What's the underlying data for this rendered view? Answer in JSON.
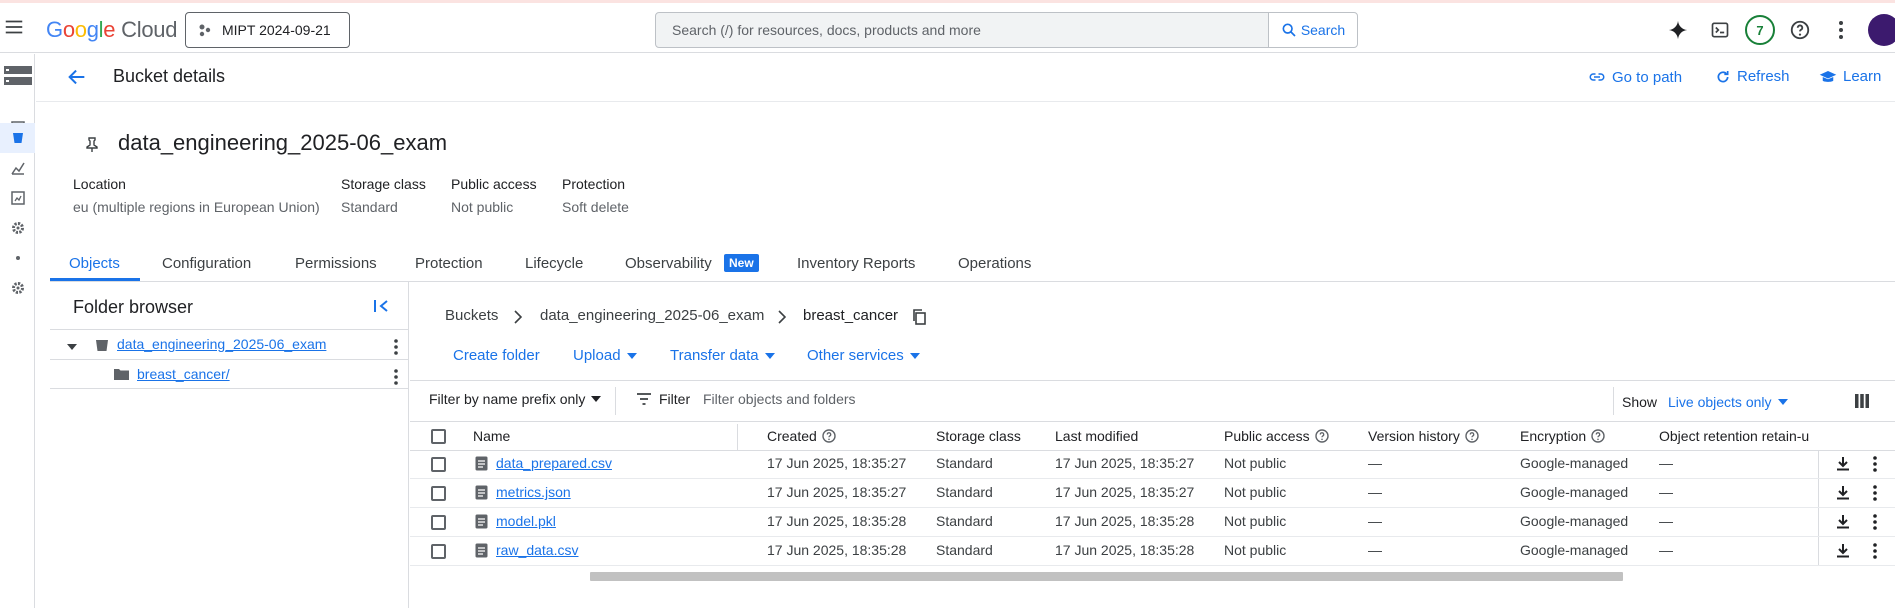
{
  "topbar": {
    "logo_google": [
      "G",
      "o",
      "o",
      "g",
      "l",
      "e"
    ],
    "logo_cloud": "Cloud",
    "project": "MIPT 2024-09-21",
    "search_placeholder": "Search (/) for resources, docs, products and more",
    "search_button": "Search",
    "notifications_count": "7"
  },
  "header": {
    "title": "Bucket details",
    "go_to_path": "Go to path",
    "refresh": "Refresh",
    "learn": "Learn"
  },
  "bucket": {
    "name": "data_engineering_2025-06_exam",
    "meta": [
      {
        "label": "Location",
        "value": "eu (multiple regions in European Union)"
      },
      {
        "label": "Storage class",
        "value": "Standard"
      },
      {
        "label": "Public access",
        "value": "Not public"
      },
      {
        "label": "Protection",
        "value": "Soft delete"
      }
    ]
  },
  "tabs": [
    "Objects",
    "Configuration",
    "Permissions",
    "Protection",
    "Lifecycle",
    "Observability",
    "Inventory Reports",
    "Operations"
  ],
  "new_badge": "New",
  "folder_browser": {
    "title": "Folder browser",
    "bucket": "data_engineering_2025-06_exam",
    "folder": "breast_cancer/"
  },
  "breadcrumb": [
    "Buckets",
    "data_engineering_2025-06_exam",
    "breast_cancer"
  ],
  "actions": {
    "create_folder": "Create folder",
    "upload": "Upload",
    "transfer": "Transfer data",
    "other": "Other services"
  },
  "filter": {
    "prefix": "Filter by name prefix only",
    "label": "Filter",
    "placeholder": "Filter objects and folders",
    "show_label": "Show",
    "show_value": "Live objects only"
  },
  "table": {
    "headers": [
      "Name",
      "Created",
      "Storage class",
      "Last modified",
      "Public access",
      "Version history",
      "Encryption",
      "Object retention retain-u"
    ],
    "rows": [
      [
        "data_prepared.csv",
        "17 Jun 2025, 18:35:27",
        "Standard",
        "17 Jun 2025, 18:35:27",
        "Not public",
        "—",
        "Google-managed",
        "—"
      ],
      [
        "metrics.json",
        "17 Jun 2025, 18:35:27",
        "Standard",
        "17 Jun 2025, 18:35:27",
        "Not public",
        "—",
        "Google-managed",
        "—"
      ],
      [
        "model.pkl",
        "17 Jun 2025, 18:35:28",
        "Standard",
        "17 Jun 2025, 18:35:28",
        "Not public",
        "—",
        "Google-managed",
        "—"
      ],
      [
        "raw_data.csv",
        "17 Jun 2025, 18:35:28",
        "Standard",
        "17 Jun 2025, 18:35:28",
        "Not public",
        "—",
        "Google-managed",
        "—"
      ]
    ]
  },
  "colors": {
    "accent": "#1a73e8",
    "text": "#202124",
    "muted": "#5f6368",
    "border": "#dadce0"
  },
  "icons": [
    "menu-icon",
    "project-icon",
    "search-icon",
    "gemini-icon",
    "terminal-icon",
    "help-icon",
    "more-vert-icon",
    "back-arrow-icon",
    "link-icon",
    "refresh-icon",
    "learn-icon",
    "pin-icon",
    "collapse-icon",
    "bucket-icon",
    "folder-icon",
    "copy-icon",
    "filter-icon",
    "columns-icon",
    "file-icon",
    "download-icon"
  ]
}
